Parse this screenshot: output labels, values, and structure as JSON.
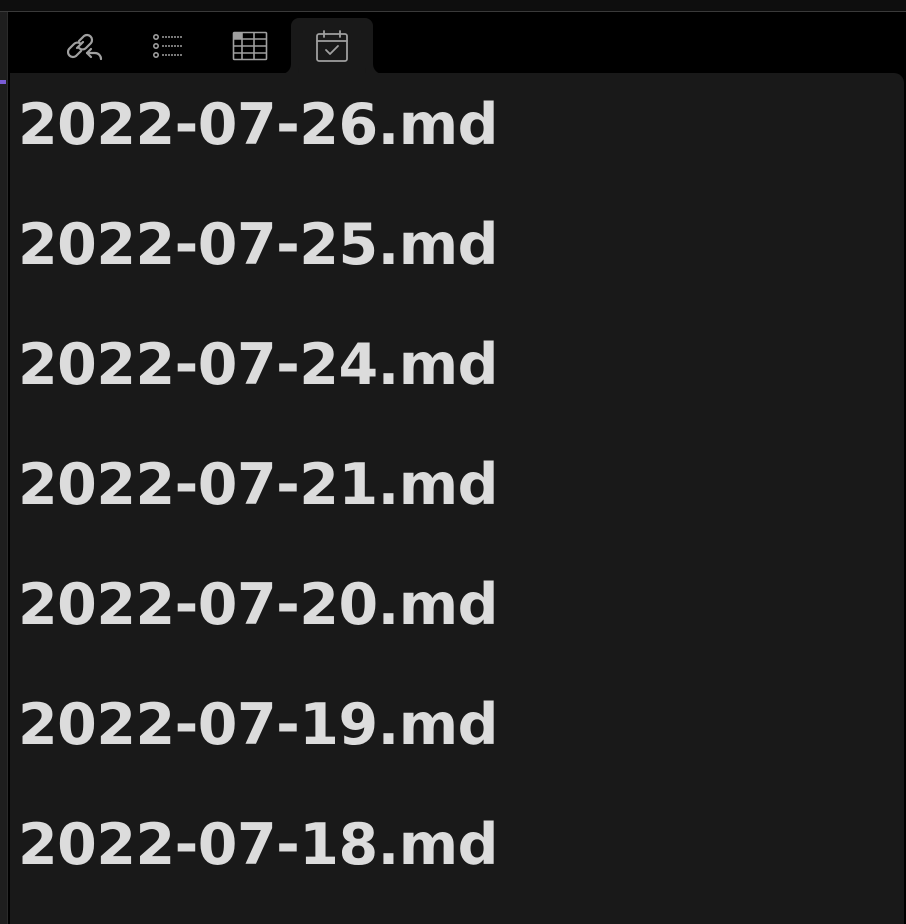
{
  "tabs": [
    {
      "id": "backlinks",
      "icon": "backlinks-icon",
      "active": false
    },
    {
      "id": "outline",
      "icon": "list-icon",
      "active": false
    },
    {
      "id": "table",
      "icon": "table-icon",
      "active": false
    },
    {
      "id": "calendar",
      "icon": "calendar-check-icon",
      "active": true
    }
  ],
  "files": [
    {
      "name": "2022-07-26.md"
    },
    {
      "name": "2022-07-25.md"
    },
    {
      "name": "2022-07-24.md"
    },
    {
      "name": "2022-07-21.md"
    },
    {
      "name": "2022-07-20.md"
    },
    {
      "name": "2022-07-19.md"
    },
    {
      "name": "2022-07-18.md"
    }
  ],
  "colors": {
    "background": "#000000",
    "panel": "#191919",
    "text": "#dcdcdc",
    "icon": "#a0a0a0",
    "accent": "#7a5cd6"
  }
}
